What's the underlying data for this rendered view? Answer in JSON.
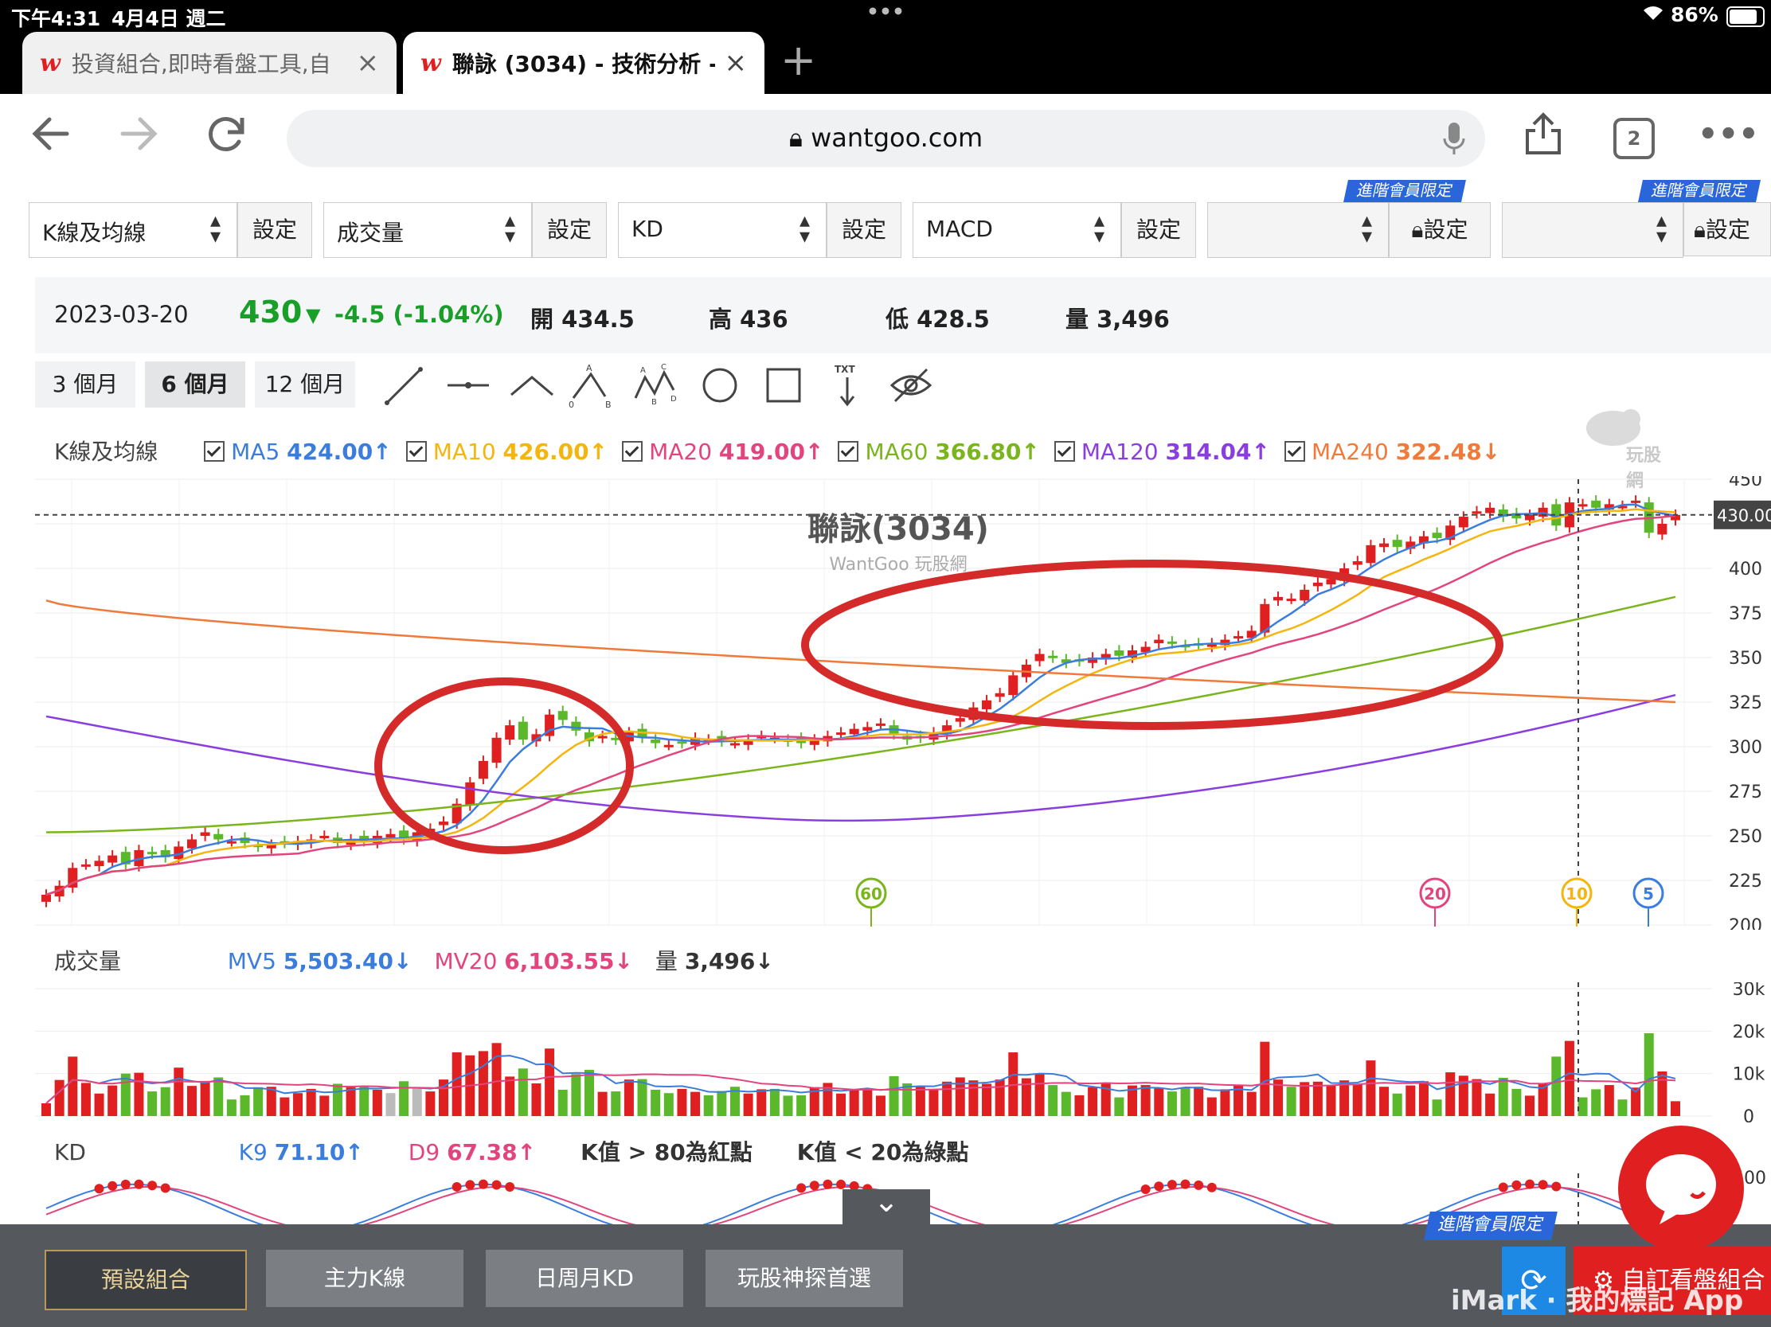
{
  "status": {
    "time": "下午4:31",
    "date": "4月4日 週二",
    "dots": "•••",
    "battery": "86%"
  },
  "tabs": [
    {
      "label": "投資組合,即時看盤工具,自",
      "active": false
    },
    {
      "label": "聯詠 (3034) - 技術分析 -",
      "active": true
    }
  ],
  "new_tab": "+",
  "url": {
    "host": "wantgoo.com",
    "tab_count": "2",
    "more": "•••"
  },
  "selectors": [
    {
      "label": "K線及均線",
      "setting": "設定",
      "locked": false
    },
    {
      "label": "成交量",
      "setting": "設定",
      "locked": false
    },
    {
      "label": "KD",
      "setting": "設定",
      "locked": false
    },
    {
      "label": "MACD",
      "setting": "設定",
      "locked": false
    },
    {
      "label": "",
      "setting": "設定",
      "locked": true
    },
    {
      "label": "",
      "setting": "設定",
      "locked": true
    }
  ],
  "vip_tag": "進階會員限定",
  "quote": {
    "date": "2023-03-20",
    "price": "430",
    "change": "-4.5 (-1.04%)",
    "open": "開 434.5",
    "high": "高 436",
    "low": "低 428.5",
    "volume": "量 3,496"
  },
  "periods": [
    "3 個月",
    "6 個月",
    "12 個月"
  ],
  "active_period": "6 個月",
  "tools": [
    "trend-line-icon",
    "horizontal-line-icon",
    "angle-icon",
    "abc-pattern-icon",
    "abcd-pattern-icon",
    "circle-icon",
    "rectangle-icon",
    "text-icon",
    "hide-drawings-icon"
  ],
  "ma_legend": {
    "title": "K線及均線",
    "items": [
      {
        "name": "MA5",
        "value": "424.00",
        "arrow": "↑",
        "color": "#3b7ddd"
      },
      {
        "name": "MA10",
        "value": "426.00",
        "arrow": "↑",
        "color": "#f5b50f"
      },
      {
        "name": "MA20",
        "value": "419.00",
        "arrow": "↑",
        "color": "#e2457e"
      },
      {
        "name": "MA60",
        "value": "366.80",
        "arrow": "↑",
        "color": "#7ab51d"
      },
      {
        "name": "MA120",
        "value": "314.04",
        "arrow": "↑",
        "color": "#8a3ee0"
      },
      {
        "name": "MA240",
        "value": "322.48",
        "arrow": "↓",
        "color": "#f07a3a"
      }
    ]
  },
  "watermark": {
    "title": "聯詠(3034)",
    "sub": "WantGoo 玩股網",
    "brand": "玩股網"
  },
  "price_axis": [
    "450",
    "400",
    "375",
    "350",
    "325",
    "300",
    "275",
    "250",
    "225",
    "200"
  ],
  "current_price_label": "430.00",
  "ma_markers": [
    {
      "label": "60",
      "color": "#7ab51d"
    },
    {
      "label": "20",
      "color": "#e2457e"
    },
    {
      "label": "10",
      "color": "#f5b50f"
    },
    {
      "label": "5",
      "color": "#3b7ddd"
    }
  ],
  "volume_legend": {
    "title": "成交量",
    "items": [
      {
        "name": "MV5",
        "value": "5,503.40",
        "arrow": "↓",
        "color": "#3b7ddd"
      },
      {
        "name": "MV20",
        "value": "6,103.55",
        "arrow": "↓",
        "color": "#e2457e"
      },
      {
        "name": "量",
        "value": "3,496",
        "arrow": "↓",
        "color": "#333333"
      }
    ]
  },
  "volume_axis": [
    "30k",
    "20k",
    "10k",
    "0"
  ],
  "kd_legend": {
    "title": "KD",
    "items": [
      {
        "name": "K9",
        "value": "71.10",
        "arrow": "↑",
        "color": "#3b7ddd"
      },
      {
        "name": "D9",
        "value": "67.38",
        "arrow": "↑",
        "color": "#e2457e"
      }
    ],
    "note1": "K值 > 80為紅點",
    "note2": "K值 < 20為綠點"
  },
  "kd_axis_partial": "00",
  "bottom_buttons": [
    "預設組合",
    "主力K線",
    "日周月KD",
    "玩股神探首選"
  ],
  "active_bottom": "預設組合",
  "custom_button": "自訂看盤組合",
  "imark": "iMark · 我的標記 App",
  "collapse_icon": "⌄",
  "chart_data": {
    "type": "candlestick",
    "title": "聯詠(3034)",
    "ylim": [
      200,
      450
    ],
    "y_ticks": [
      450,
      400,
      375,
      350,
      325,
      300,
      275,
      250,
      225,
      200
    ],
    "close": [
      217,
      222,
      232,
      234,
      236,
      239,
      234,
      242,
      240,
      238,
      244,
      248,
      252,
      248,
      247,
      246,
      244,
      245,
      246,
      247,
      248,
      250,
      246,
      248,
      247,
      250,
      251,
      248,
      252,
      254,
      258,
      268,
      280,
      292,
      305,
      312,
      304,
      307,
      318,
      315,
      309,
      303,
      306,
      304,
      308,
      305,
      302,
      301,
      302,
      305,
      304,
      303,
      302,
      304,
      306,
      305,
      303,
      302,
      304,
      306,
      308,
      310,
      311,
      313,
      307,
      304,
      305,
      308,
      312,
      316,
      322,
      326,
      330,
      340,
      346,
      352,
      350,
      347,
      348,
      350,
      352,
      351,
      354,
      356,
      360,
      358,
      356,
      357,
      358,
      360,
      362,
      365,
      380,
      384,
      383,
      388,
      392,
      394,
      400,
      404,
      413,
      414,
      412,
      415,
      418,
      417,
      424,
      429,
      432,
      434,
      429,
      428,
      430,
      434,
      424,
      437,
      436,
      434,
      436,
      435,
      438,
      420,
      425,
      430
    ],
    "ma240_series": [
      382,
      325
    ],
    "ma120_series": [
      318,
      268,
      262,
      330
    ],
    "volume_ylim": [
      0,
      30000
    ],
    "volume_ticks": [
      30000,
      20000,
      10000,
      0
    ],
    "volume_last": 3496,
    "mv5": 5503.4,
    "mv20": 6103.55,
    "k9": 71.1,
    "d9": 67.38
  }
}
